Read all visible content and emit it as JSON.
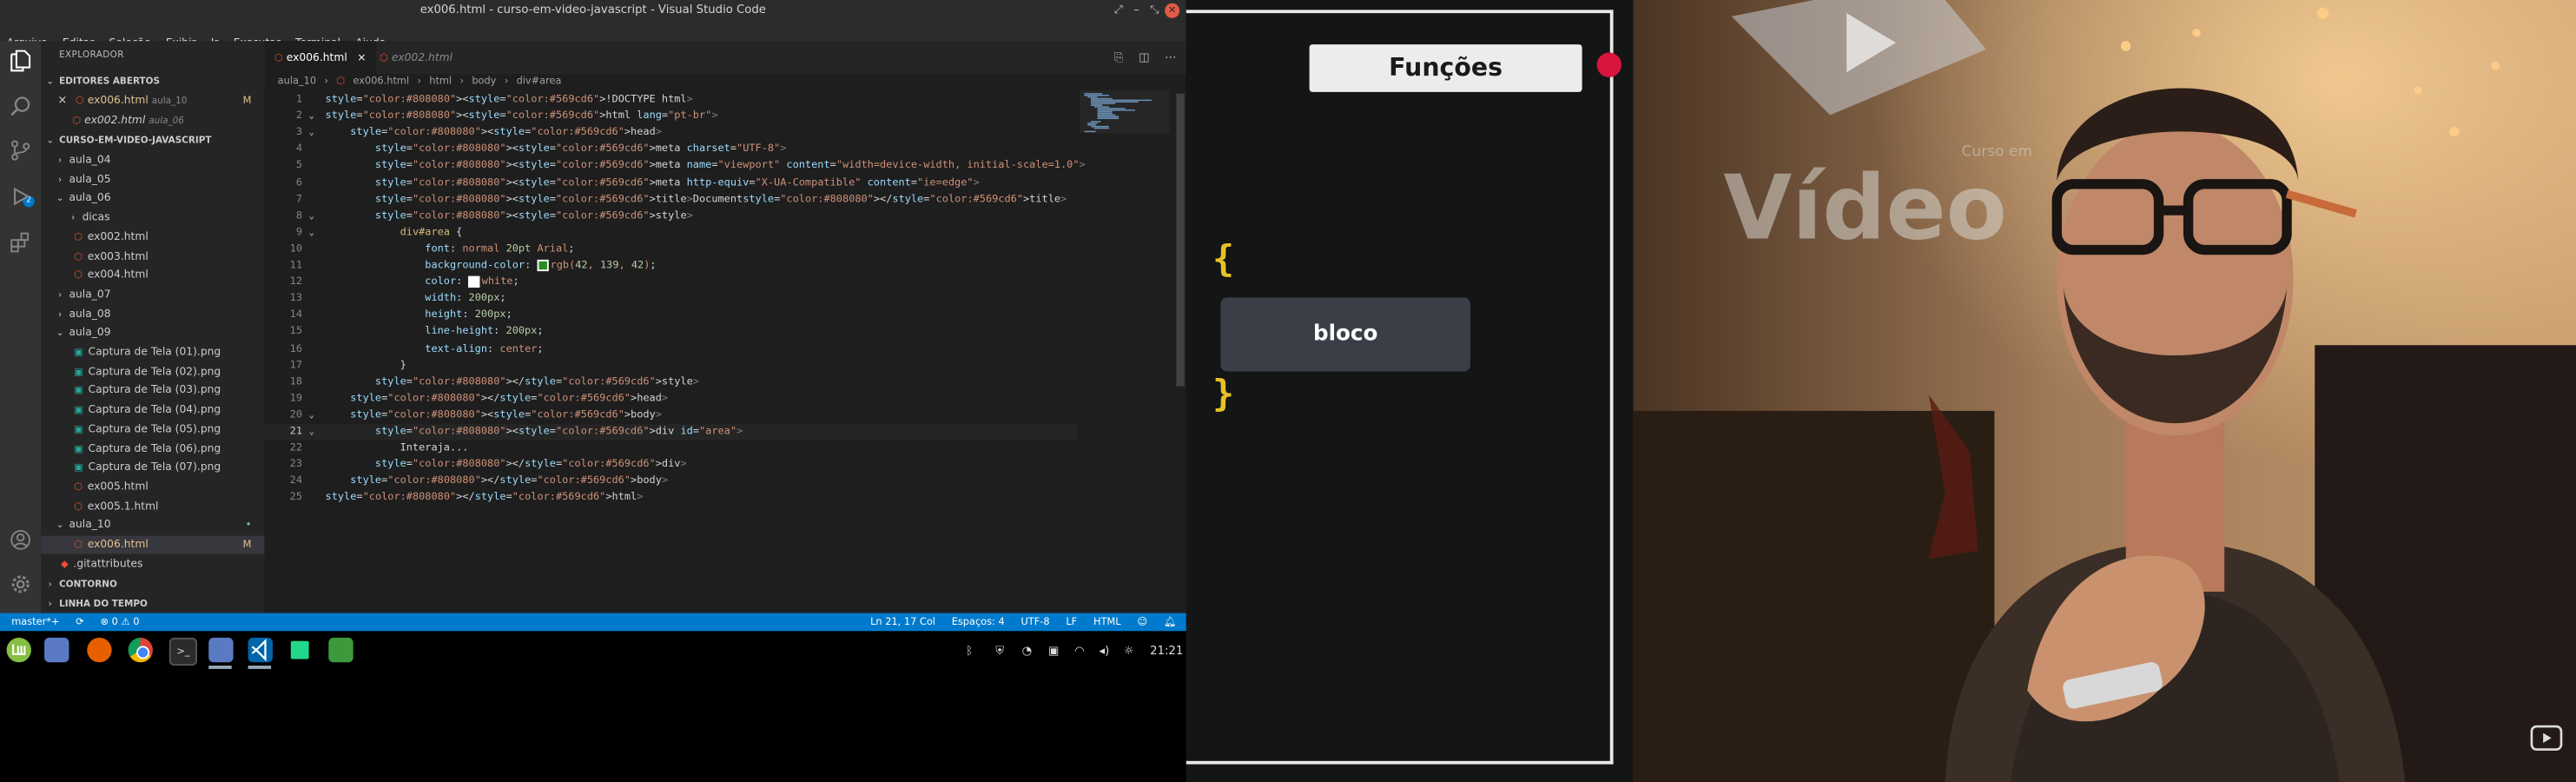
{
  "window": {
    "title": "ex006.html - curso-em-video-javascript - Visual Studio Code",
    "controls": [
      "⤢",
      "–",
      "⤡",
      "✕"
    ]
  },
  "menu": [
    "Arquivo",
    "Editar",
    "Seleção",
    "Exibir",
    "Ir",
    "Executar",
    "Terminal",
    "Ajuda"
  ],
  "activity": {
    "badge": "2"
  },
  "explorer": {
    "title": "EXPLORADOR",
    "open_editors_header": "EDITORES ABERTOS",
    "open_editors": [
      {
        "name": "ex006.html",
        "folder": "aula_10",
        "mark": "M"
      },
      {
        "name": "ex002.html",
        "folder": "aula_06",
        "mark": ""
      }
    ],
    "project_header": "CURSO-EM-VIDEO-JAVASCRIPT",
    "tree": [
      {
        "label": "aula_04",
        "type": "folder",
        "open": false,
        "depth": 1
      },
      {
        "label": "aula_05",
        "type": "folder",
        "open": false,
        "depth": 1
      },
      {
        "label": "aula_06",
        "type": "folder",
        "open": true,
        "depth": 1
      },
      {
        "label": "dicas",
        "type": "folder",
        "open": false,
        "depth": 2
      },
      {
        "label": "ex002.html",
        "type": "html",
        "depth": 2
      },
      {
        "label": "ex003.html",
        "type": "html",
        "depth": 2
      },
      {
        "label": "ex004.html",
        "type": "html",
        "depth": 2
      },
      {
        "label": "aula_07",
        "type": "folder",
        "open": false,
        "depth": 1
      },
      {
        "label": "aula_08",
        "type": "folder",
        "open": false,
        "depth": 1
      },
      {
        "label": "aula_09",
        "type": "folder",
        "open": true,
        "depth": 1
      },
      {
        "label": "Captura de Tela (01).png",
        "type": "image",
        "depth": 2
      },
      {
        "label": "Captura de Tela (02).png",
        "type": "image",
        "depth": 2
      },
      {
        "label": "Captura de Tela (03).png",
        "type": "image",
        "depth": 2
      },
      {
        "label": "Captura de Tela (04).png",
        "type": "image",
        "depth": 2
      },
      {
        "label": "Captura de Tela (05).png",
        "type": "image",
        "depth": 2
      },
      {
        "label": "Captura de Tela (06).png",
        "type": "image",
        "depth": 2
      },
      {
        "label": "Captura de Tela (07).png",
        "type": "image",
        "depth": 2
      },
      {
        "label": "ex005.html",
        "type": "html",
        "depth": 2
      },
      {
        "label": "ex005.1.html",
        "type": "html",
        "depth": 2
      },
      {
        "label": "aula_10",
        "type": "folder",
        "open": true,
        "depth": 1,
        "mark": "•"
      },
      {
        "label": "ex006.html",
        "type": "html",
        "depth": 2,
        "mark": "M",
        "selected": true
      },
      {
        "label": ".gitattributes",
        "type": "git",
        "depth": 1
      }
    ],
    "outline_header": "CONTORNO",
    "timeline_header": "LINHA DO TEMPO"
  },
  "tabs": [
    {
      "label": "ex006.html",
      "active": true,
      "close": "×"
    },
    {
      "label": "ex002.html",
      "active": false
    }
  ],
  "tab_actions": [
    "⎘",
    "◫",
    "⋯"
  ],
  "breadcrumb": [
    "aula_10",
    "›",
    "ex006.html",
    "›",
    "html",
    "›",
    "body",
    "›",
    "div#area"
  ],
  "code_lines": [
    "<!DOCTYPE html>",
    "<html lang=\"pt-br\">",
    "    <head>",
    "        <meta charset=\"UTF-8\">",
    "        <meta name=\"viewport\" content=\"width=device-width, initial-scale=1.0\">",
    "        <meta http-equiv=\"X-UA-Compatible\" content=\"ie=edge\">",
    "        <title>Document</title>",
    "        <style>",
    "            div#area {",
    "                font: normal 20pt Arial;",
    "                background-color: rgb(42, 139, 42);",
    "                color: white;",
    "                width: 200px;",
    "                height: 200px;",
    "                line-height: 200px;",
    "                text-align: center;",
    "            }",
    "        </style>",
    "    </head>",
    "    <body>",
    "        <div id=\"area\">",
    "            Interaja...",
    "        </div>",
    "    </body>",
    "</html>"
  ],
  "cursor_line": 21,
  "colors": {
    "swatch_green": "#2a8b2a",
    "swatch_white": "#ffffff",
    "status_bar": "#007acc",
    "accent_red": "#d6163f",
    "brace_yellow": "#e6c228"
  },
  "status": {
    "branch": "master*+",
    "sync": "⟳",
    "problems": "⊗ 0 ⚠ 0",
    "position": "Ln 21, 17 Col",
    "spaces": "Espaços: 4",
    "encoding": "UTF-8",
    "eol": "LF",
    "language": "HTML"
  },
  "taskbar": {
    "clock": "21:21"
  },
  "video": {
    "heading": "Funções",
    "open_brace": "{",
    "block_label": "bloco",
    "close_brace": "}",
    "sign_text": "Vídeo",
    "sign_small": "Curso em"
  }
}
